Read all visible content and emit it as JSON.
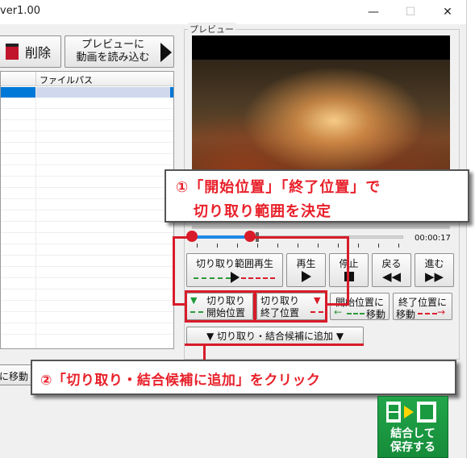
{
  "window": {
    "title": "ver1.00",
    "minimize": "—",
    "maximize": "☐",
    "close": "✕"
  },
  "toolbar": {
    "delete_label": "削除",
    "load_preview_line1": "プレビューに",
    "load_preview_line2": "動画を読み込む"
  },
  "filelist": {
    "col_path": "ファイルパス"
  },
  "preview": {
    "group_label": "プレビュー",
    "time": "00:00:17"
  },
  "controls": {
    "range_play": "切り取り範囲再生",
    "play": "再生",
    "stop": "停止",
    "back": "戻る",
    "forward": "進む",
    "cut_start_line1": "切り取り",
    "cut_start_line2": "開始位置",
    "cut_end_line1": "切り取り",
    "cut_end_line2": "終了位置",
    "goto_start_line1": "開始位置に",
    "goto_start_line2": "移動",
    "goto_end_line1": "終了位置に",
    "goto_end_line2": "移動",
    "add_candidate": "切り取り・結合候補に追加"
  },
  "bottom": {
    "move_button": "に移動",
    "merge_save_line1": "結合して",
    "merge_save_line2": "保存する"
  },
  "annotations": {
    "callout1_line1": "①「開始位置」「終了位置」で",
    "callout1_line2": "切り取り範囲を決定",
    "callout2": "②「切り取り・結合候補に追加」をクリック"
  },
  "colors": {
    "accent_red": "#d81c2a",
    "green": "#1a9a40",
    "selection_blue": "#0078d7"
  }
}
